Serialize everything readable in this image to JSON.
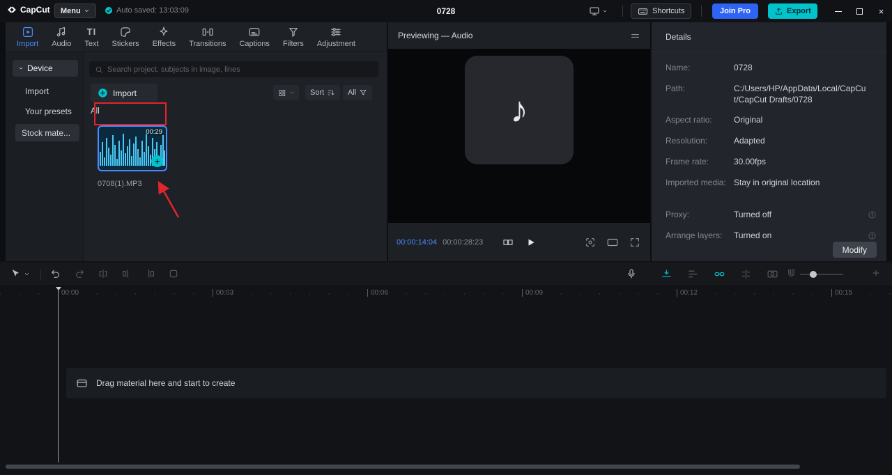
{
  "colors": {
    "accent": "#00c3cc",
    "active_blue": "#4a8cff",
    "pro_blue": "#2e63f4",
    "annotation_red": "#e0262b"
  },
  "titlebar": {
    "app_name": "CapCut",
    "menu_label": "Menu",
    "autosave_text": "Auto saved: 13:03:09",
    "project_title": "0728",
    "shortcuts_label": "Shortcuts",
    "join_pro_label": "Join Pro",
    "export_label": "Export"
  },
  "media_panel": {
    "tabs": [
      {
        "label": "Import",
        "active": true
      },
      {
        "label": "Audio"
      },
      {
        "label": "Text"
      },
      {
        "label": "Stickers"
      },
      {
        "label": "Effects"
      },
      {
        "label": "Transitions"
      },
      {
        "label": "Captions"
      },
      {
        "label": "Filters"
      },
      {
        "label": "Adjustment"
      }
    ],
    "sidebar": {
      "device_label": "Device",
      "items": [
        "Import",
        "Your presets"
      ],
      "stock_label": "Stock mate..."
    },
    "search_placeholder": "Search project, subjects in image, lines",
    "import_button_label": "Import",
    "sort_label": "Sort",
    "filter_label": "All",
    "section_label": "All",
    "clip": {
      "duration": "00:29",
      "filename": "0708(1).MP3"
    }
  },
  "preview_panel": {
    "title": "Previewing — Audio",
    "current_time": "00:00:14:04",
    "total_time": "00:00:28:23"
  },
  "details_panel": {
    "title": "Details",
    "rows": [
      {
        "label": "Name:",
        "value": "0728"
      },
      {
        "label": "Path:",
        "value": "C:/Users/HP/AppData/Local/CapCut/CapCut Drafts/0728"
      },
      {
        "label": "Aspect ratio:",
        "value": "Original"
      },
      {
        "label": "Resolution:",
        "value": "Adapted"
      },
      {
        "label": "Frame rate:",
        "value": "30.00fps"
      },
      {
        "label": "Imported media:",
        "value": "Stay in original location"
      },
      {
        "label": "Proxy:",
        "value": "Turned off"
      },
      {
        "label": "Arrange layers:",
        "value": "Turned on"
      }
    ],
    "modify_label": "Modify"
  },
  "timeline": {
    "ruler": [
      "00:00",
      "00:03",
      "00:06",
      "00:09",
      "00:12",
      "00:15"
    ],
    "empty_text": "Drag material here and start to create"
  }
}
